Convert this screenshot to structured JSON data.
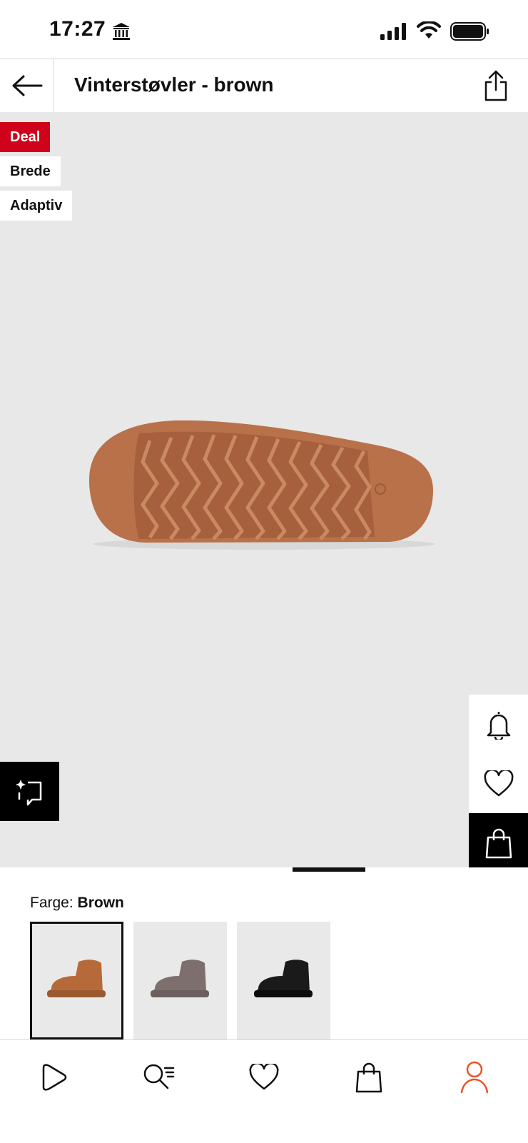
{
  "status_bar": {
    "time": "17:27"
  },
  "header": {
    "title": "Vinterstøvler - brown"
  },
  "badges": [
    "Deal",
    "Brede",
    "Adaptiv"
  ],
  "color_selector": {
    "label": "Farge:",
    "value": "Brown",
    "swatches": [
      "brown",
      "grey",
      "black"
    ],
    "selected": 0
  },
  "colors": {
    "deal_red": "#d0021b",
    "accent_orange": "#e8542a",
    "image_bg": "#e8e8e8",
    "sole": "#b9714a"
  },
  "icons": [
    "bank-icon",
    "signal-icon",
    "wifi-icon",
    "battery-icon",
    "back-arrow-icon",
    "share-icon",
    "bell-icon",
    "heart-icon",
    "shopping-bag-icon",
    "ai-sparkle-icon",
    "play-icon",
    "search-icon",
    "heart-icon",
    "bag-icon",
    "profile-icon"
  ],
  "bottom_nav": [
    "play",
    "search",
    "favorites",
    "bag",
    "profile"
  ]
}
